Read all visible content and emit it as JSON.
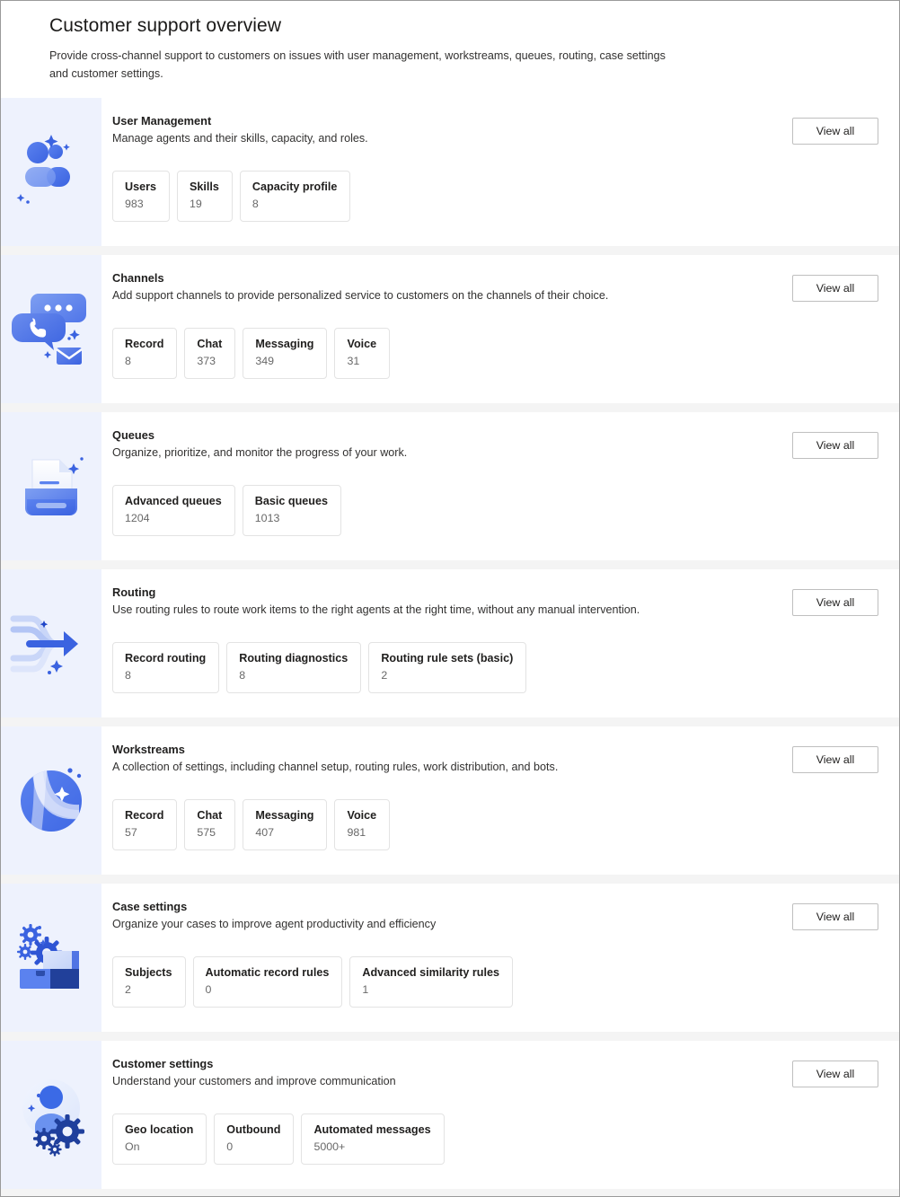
{
  "header": {
    "title": "Customer support overview",
    "subtitle": "Provide cross-channel support to customers on issues with user management, workstreams, queues, routing, case settings and customer settings."
  },
  "common": {
    "view_all_label": "View all"
  },
  "colors": {
    "art_panel_bg": "#eef2fd",
    "accent_blue": "#3b63e0",
    "accent_blue_light": "#7b9af0",
    "page_bg": "#f4f4f4",
    "card_bg": "#ffffff",
    "border": "#e3e3e3"
  },
  "cards": [
    {
      "id": "user-management",
      "icon": "people-icon",
      "title": "User Management",
      "description": "Manage agents and their skills, capacity, and roles.",
      "view_all_label": "View all",
      "stats": [
        {
          "label": "Users",
          "value": "983"
        },
        {
          "label": "Skills",
          "value": "19"
        },
        {
          "label": "Capacity profile",
          "value": "8"
        }
      ]
    },
    {
      "id": "channels",
      "icon": "chat-phone-mail-icon",
      "title": "Channels",
      "description": "Add support channels to provide personalized service to customers on the channels of their choice.",
      "view_all_label": "View all",
      "stats": [
        {
          "label": "Record",
          "value": "8"
        },
        {
          "label": "Chat",
          "value": "373"
        },
        {
          "label": "Messaging",
          "value": "349"
        },
        {
          "label": "Voice",
          "value": "31"
        }
      ]
    },
    {
      "id": "queues",
      "icon": "document-tray-icon",
      "title": "Queues",
      "description": "Organize, prioritize, and monitor the progress of your work.",
      "view_all_label": "View all",
      "stats": [
        {
          "label": "Advanced queues",
          "value": "1204"
        },
        {
          "label": "Basic queues",
          "value": "1013"
        }
      ]
    },
    {
      "id": "routing",
      "icon": "routing-arrow-icon",
      "title": "Routing",
      "description": "Use routing rules to route work items to the right agents at the right time, without any manual intervention.",
      "view_all_label": "View all",
      "stats": [
        {
          "label": "Record routing",
          "value": "8"
        },
        {
          "label": "Routing diagnostics",
          "value": "8"
        },
        {
          "label": "Routing rule sets (basic)",
          "value": "2"
        }
      ]
    },
    {
      "id": "workstreams",
      "icon": "sphere-swoosh-icon",
      "title": "Workstreams",
      "description": "A collection of settings, including channel setup, routing rules, work distribution, and bots.",
      "view_all_label": "View all",
      "stats": [
        {
          "label": "Record",
          "value": "57"
        },
        {
          "label": "Chat",
          "value": "575"
        },
        {
          "label": "Messaging",
          "value": "407"
        },
        {
          "label": "Voice",
          "value": "981"
        }
      ]
    },
    {
      "id": "case-settings",
      "icon": "briefcase-gears-icon",
      "title": "Case settings",
      "description": "Organize your cases to improve agent productivity and efficiency",
      "view_all_label": "View all",
      "stats": [
        {
          "label": "Subjects",
          "value": "2"
        },
        {
          "label": "Automatic record rules",
          "value": "0"
        },
        {
          "label": "Advanced similarity rules",
          "value": "1"
        }
      ]
    },
    {
      "id": "customer-settings",
      "icon": "person-gears-icon",
      "title": "Customer settings",
      "description": "Understand your customers and improve communication",
      "view_all_label": "View all",
      "stats": [
        {
          "label": "Geo location",
          "value": "On"
        },
        {
          "label": "Outbound",
          "value": "0"
        },
        {
          "label": "Automated messages",
          "value": "5000+"
        }
      ]
    }
  ]
}
